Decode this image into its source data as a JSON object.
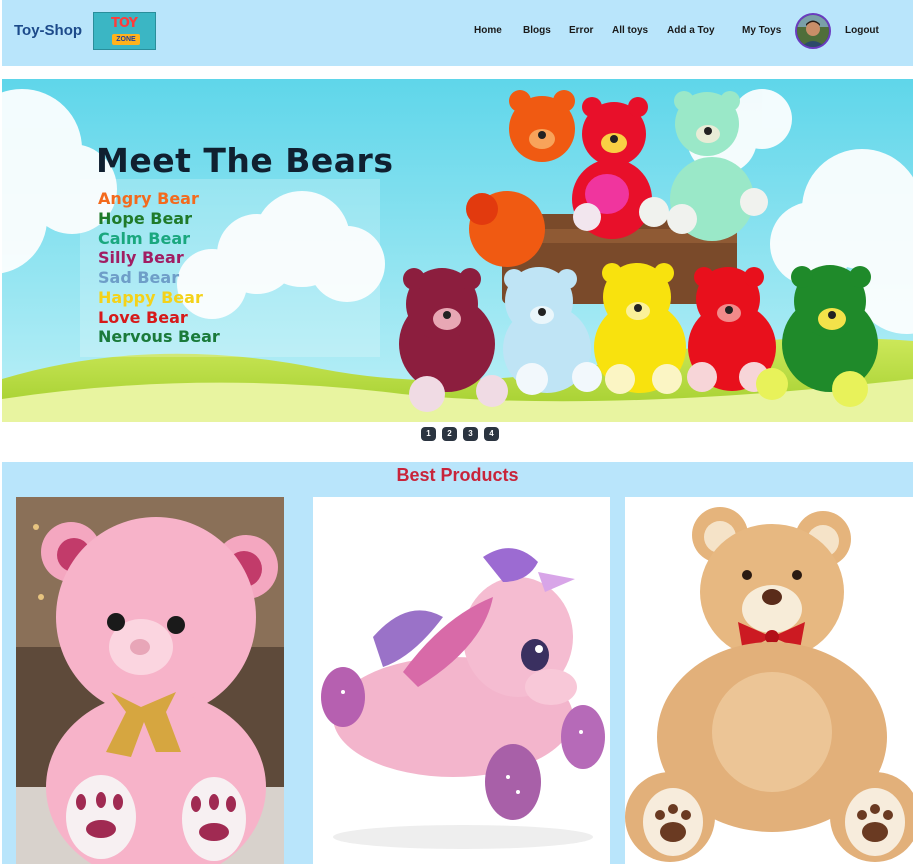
{
  "navbar": {
    "brand": "Toy-Shop",
    "logo_text_top": "TOY",
    "logo_text_bottom": "ZONE",
    "links": [
      {
        "label": "Home"
      },
      {
        "label": "Blogs"
      },
      {
        "label": "Error"
      },
      {
        "label": "All toys"
      },
      {
        "label": "Add a Toy"
      },
      {
        "label": "My Toys"
      },
      {
        "label": "Logout"
      }
    ]
  },
  "banner": {
    "title": "Meet The Bears",
    "bears": [
      {
        "label": "Angry Bear",
        "color": "#f36a1d"
      },
      {
        "label": "Hope Bear",
        "color": "#1f7a2a"
      },
      {
        "label": "Calm Bear",
        "color": "#1aa77e"
      },
      {
        "label": "Silly Bear",
        "color": "#a11e63"
      },
      {
        "label": "Sad Bear",
        "color": "#6e9ec8"
      },
      {
        "label": "Happy Bear",
        "color": "#f4d21a"
      },
      {
        "label": "Love Bear",
        "color": "#d61a1a"
      },
      {
        "label": "Nervous Bear",
        "color": "#1a7a3a"
      }
    ]
  },
  "carousel": {
    "slides": [
      "1",
      "2",
      "3",
      "4"
    ]
  },
  "best_products": {
    "title": "Best Products"
  },
  "colors": {
    "nav_bg": "#b9e5fb",
    "brand": "#1c4a8a",
    "section_title": "#c8243a"
  }
}
